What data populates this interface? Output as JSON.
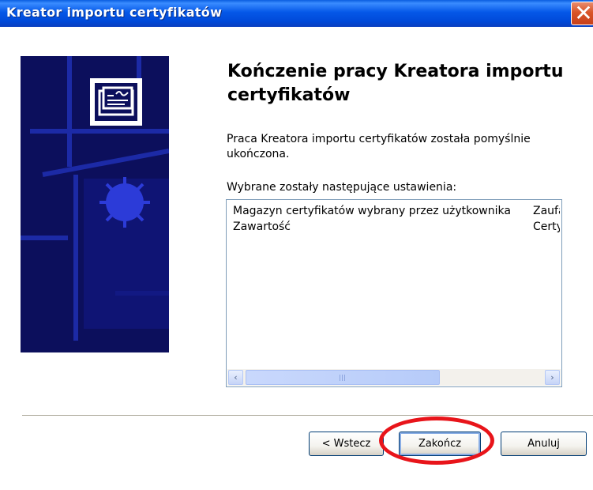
{
  "window": {
    "title": "Kreator importu certyfikatów",
    "close_glyph": "✕"
  },
  "side_image": {
    "icon": "certificate-icon"
  },
  "main": {
    "heading": "Kończenie pracy Kreatora importu certyfikatów",
    "description": "Praca Kreatora importu certyfikatów została pomyślnie ukończona.",
    "settings_label": "Wybrane zostały następujące ustawienia:",
    "settings": [
      {
        "key": "Magazyn certyfikatów wybrany przez użytkownika",
        "value": "Zaufane"
      },
      {
        "key": "Zawartość",
        "value": "Certyfikat"
      }
    ]
  },
  "scrollbar": {
    "left_glyph": "‹",
    "right_glyph": "›"
  },
  "buttons": {
    "back": "< Wstecz",
    "finish": "Zakończ",
    "cancel": "Anuluj"
  },
  "colors": {
    "titlebar": "#0558E8",
    "close": "#D95428",
    "annotation": "#E8141A"
  }
}
